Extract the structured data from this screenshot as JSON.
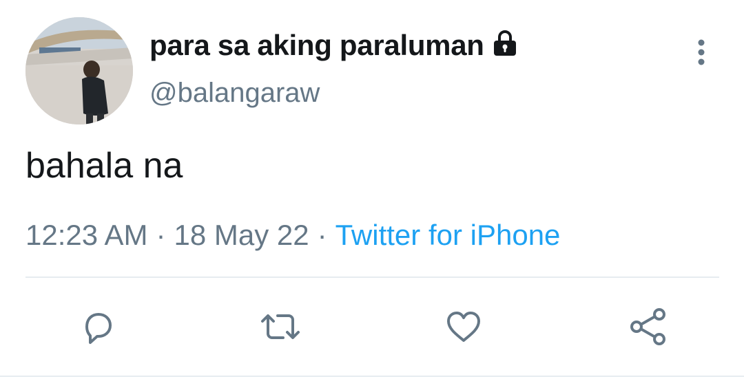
{
  "author": {
    "display_name": "para sa aking paraluman",
    "handle": "@balangaraw",
    "protected_icon": "lock-icon",
    "avatar_description_icon": "avatar"
  },
  "tweet": {
    "text": "bahala na",
    "time": "12:23 AM",
    "separator": "·",
    "date": "18 May 22",
    "source": "Twitter for iPhone"
  },
  "icons": {
    "more": "more-vertical-icon",
    "reply": "reply-icon",
    "retweet": "retweet-icon",
    "like": "heart-icon",
    "share": "share-icon"
  },
  "colors": {
    "text_primary": "#14171a",
    "text_secondary": "#657786",
    "link": "#1da1f2",
    "divider": "#e6ecf0"
  }
}
